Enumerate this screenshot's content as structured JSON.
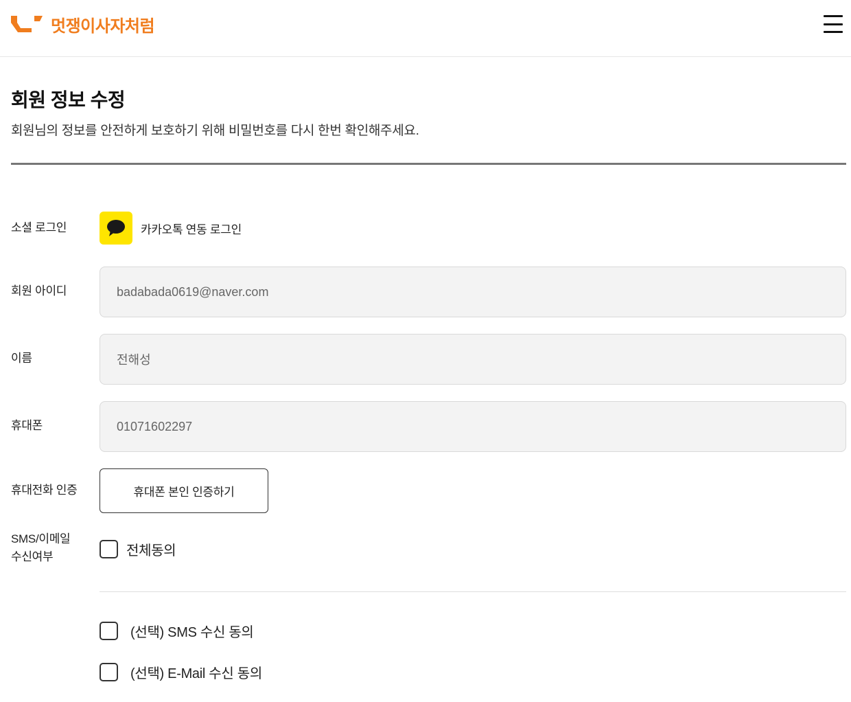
{
  "header": {
    "brand_name": "멋쟁이사자처럼",
    "brand_color": "#f07d1e",
    "logo_icon": "likelion-logo-icon",
    "menu_icon": "hamburger-menu-icon"
  },
  "page": {
    "title": "회원 정보 수정",
    "description": "회원님의 정보를 안전하게 보호하기 위해 비밀번호를 다시 한번 확인해주세요."
  },
  "form": {
    "social_login": {
      "label": "소셜 로그인",
      "provider_icon": "kakao-talk-icon",
      "provider_color": "#fee500",
      "text": "카카오톡 연동 로그인"
    },
    "member_id": {
      "label": "회원 아이디",
      "value": "badabada0619@naver.com"
    },
    "name": {
      "label": "이름",
      "value": "전해성"
    },
    "phone": {
      "label": "휴대폰",
      "value": "01071602297"
    },
    "phone_verification": {
      "label": "휴대전화 인증",
      "button_label": "휴대폰 본인 인증하기"
    },
    "marketing_consent": {
      "label_line1": "SMS/이메일",
      "label_line2": "수신여부",
      "agree_all_label": "전체동의",
      "agree_all_checked": false,
      "options": [
        {
          "label": "(선택) SMS 수신 동의",
          "checked": false
        },
        {
          "label": "(선택) E-Mail 수신 동의",
          "checked": false
        }
      ]
    }
  }
}
